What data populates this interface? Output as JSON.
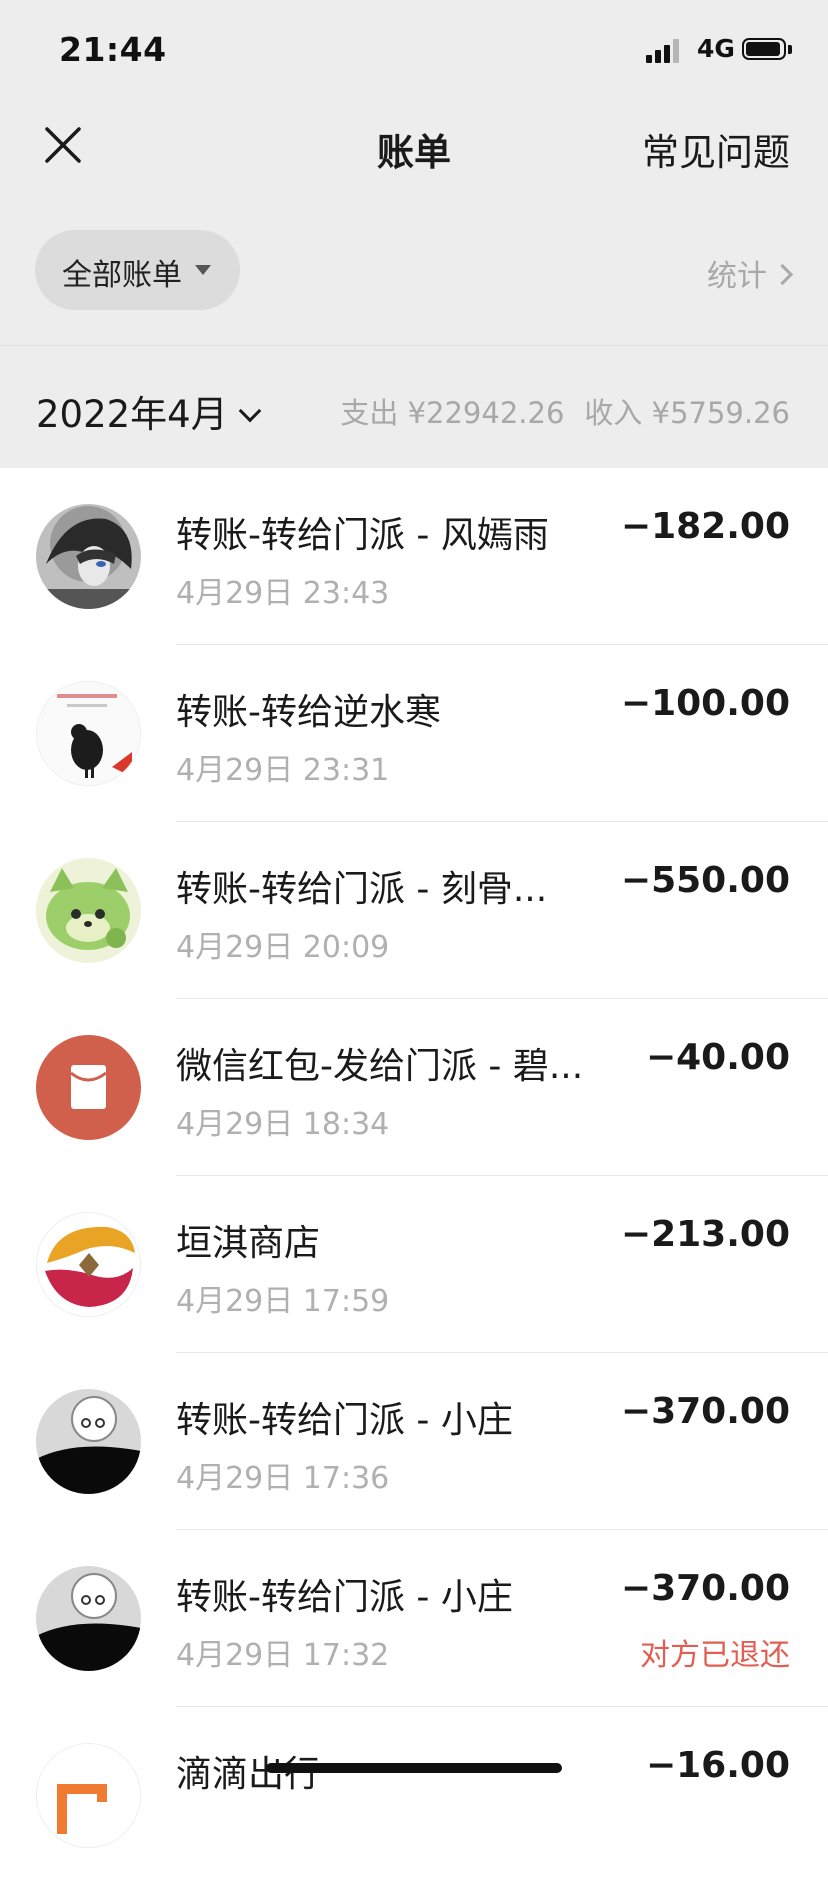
{
  "status_bar": {
    "time": "21:44",
    "network": "4G"
  },
  "nav": {
    "title": "账单",
    "faq_label": "常见问题"
  },
  "filter": {
    "label": "全部账单",
    "stats_label": "统计"
  },
  "month_bar": {
    "month": "2022年4月",
    "expense": "支出 ¥22942.26",
    "income": "收入 ¥5759.26"
  },
  "transactions": [
    {
      "title": "转账-转给门派 - 风嫣雨",
      "time": "4月29日 23:43",
      "amount": "−182.00",
      "note": "",
      "avatar": "anime-avatar"
    },
    {
      "title": "转账-转给逆水寒",
      "time": "4月29日 23:31",
      "amount": "−100.00",
      "note": "",
      "avatar": "game-logo-avatar"
    },
    {
      "title": "转账-转给门派 - 刻骨...",
      "time": "4月29日 20:09",
      "amount": "−550.00",
      "note": "",
      "avatar": "green-cat-avatar"
    },
    {
      "title": "微信红包-发给门派 - 碧...",
      "time": "4月29日 18:34",
      "amount": "−40.00",
      "note": "",
      "avatar": "red-packet-icon"
    },
    {
      "title": "垣淇商店",
      "time": "4月29日 17:59",
      "amount": "−213.00",
      "note": "",
      "avatar": "bank-logo-avatar"
    },
    {
      "title": "转账-转给门派 - 小庄",
      "time": "4月29日 17:36",
      "amount": "−370.00",
      "note": "",
      "avatar": "bw-sketch-avatar"
    },
    {
      "title": "转账-转给门派 - 小庄",
      "time": "4月29日 17:32",
      "amount": "−370.00",
      "note": "对方已退还",
      "avatar": "bw-sketch-avatar"
    },
    {
      "title": "滴滴出行",
      "time": "",
      "amount": "−16.00",
      "note": "",
      "avatar": "didi-avatar"
    }
  ],
  "colors": {
    "background": "#ededed",
    "note_red": "#e25d52",
    "red_packet": "#d0604c"
  }
}
